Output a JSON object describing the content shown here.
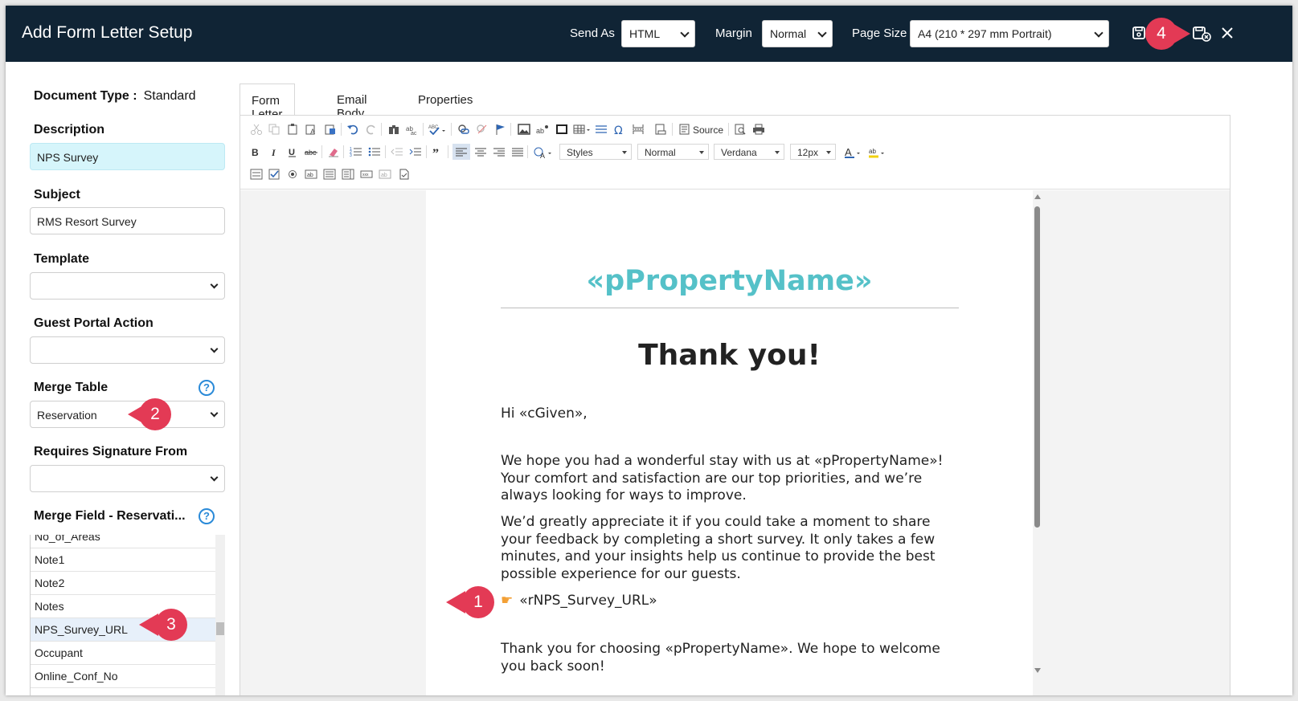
{
  "header": {
    "title": "Add Form Letter Setup",
    "send_as_label": "Send As",
    "send_as_value": "HTML",
    "margin_label": "Margin",
    "margin_value": "Normal",
    "page_size_label": "Page Size",
    "page_size_value": "A4 (210 * 297 mm Portrait)"
  },
  "left": {
    "document_type_label": "Document Type :",
    "document_type_value": "Standard",
    "description_label": "Description",
    "description_value": "NPS Survey",
    "subject_label": "Subject",
    "subject_value": "RMS Resort Survey",
    "template_label": "Template",
    "template_value": "",
    "guest_portal_label": "Guest Portal Action",
    "guest_portal_value": "",
    "merge_table_label": "Merge Table",
    "merge_table_value": "Reservation",
    "requires_signature_label": "Requires Signature From",
    "requires_signature_value": "",
    "merge_field_label": "Merge Field - Reservati...",
    "merge_fields": [
      "No_of_Areas",
      "Note1",
      "Note2",
      "Notes",
      "NPS_Survey_URL",
      "Occupant",
      "Online_Conf_No"
    ]
  },
  "tabs": [
    "Form Letter",
    "Email Body",
    "Properties"
  ],
  "toolbar": {
    "source_label": "Source",
    "styles": "Styles",
    "format": "Normal",
    "font": "Verdana",
    "size": "12px"
  },
  "letter": {
    "property_name": "«pPropertyName»",
    "heading": "Thank you!",
    "greeting": "Hi «cGiven»,",
    "para1": "We hope you had a wonderful stay with us at «pPropertyName»! Your comfort and satisfaction are our top priorities, and we’re always looking for ways to improve.",
    "para2": "We’d greatly appreciate it if you could take a moment to share your feedback by completing a short survey. It only takes a few minutes, and your insights help us continue to provide the best possible experience for our guests.",
    "survey_link": "«rNPS_Survey_URL»",
    "closing": "Thank you for choosing «pPropertyName». We hope to welcome you back soon!"
  },
  "callouts": [
    "1",
    "2",
    "3",
    "4"
  ],
  "colors": {
    "header_bg": "#102435",
    "accent_teal": "#55c1c8",
    "callout": "#e33a55",
    "description_bg": "#d6f5fb"
  }
}
